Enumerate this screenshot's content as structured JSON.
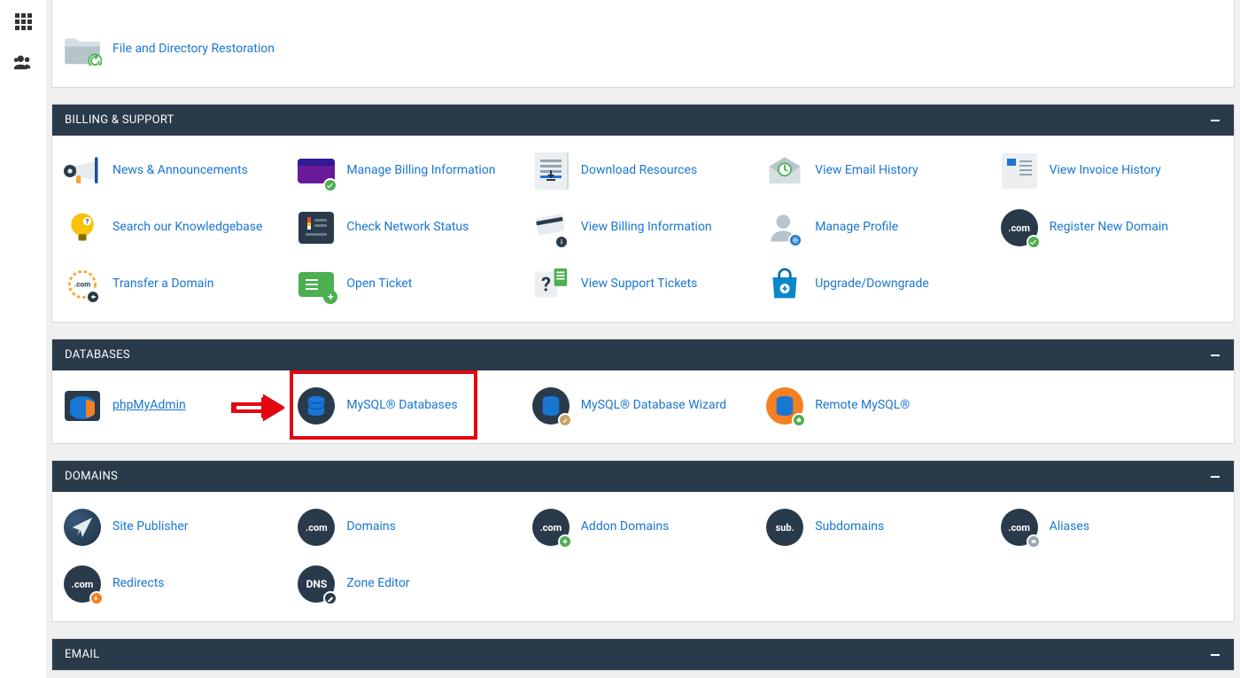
{
  "top": {
    "file_restore": "File and Directory Restoration"
  },
  "billing": {
    "header": "Billing & Support",
    "items": [
      {
        "key": "news",
        "label": "News & Announcements",
        "icon": "bullhorn-icon"
      },
      {
        "key": "manage_billing",
        "label": "Manage Billing Information",
        "icon": "credit-card-icon"
      },
      {
        "key": "download_resources",
        "label": "Download Resources",
        "icon": "download-doc-icon"
      },
      {
        "key": "email_history",
        "label": "View Email History",
        "icon": "envelope-check-icon"
      },
      {
        "key": "invoice_history",
        "label": "View Invoice History",
        "icon": "invoice-list-icon"
      },
      {
        "key": "knowledgebase",
        "label": "Search our Knowledgebase",
        "icon": "lightbulb-icon"
      },
      {
        "key": "network_status",
        "label": "Check Network Status",
        "icon": "gauge-icon"
      },
      {
        "key": "billing_info",
        "label": "View Billing Information",
        "icon": "card-swipe-icon"
      },
      {
        "key": "manage_profile",
        "label": "Manage Profile",
        "icon": "user-gear-icon"
      },
      {
        "key": "register_domain",
        "label": "Register New Domain",
        "icon": "dotcom-check-icon"
      },
      {
        "key": "transfer_domain",
        "label": "Transfer a Domain",
        "icon": "dotcom-transfer-icon"
      },
      {
        "key": "open_ticket",
        "label": "Open Ticket",
        "icon": "ticket-plus-icon"
      },
      {
        "key": "view_tickets",
        "label": "View Support Tickets",
        "icon": "question-ticket-icon"
      },
      {
        "key": "upgrade",
        "label": "Upgrade/Downgrade",
        "icon": "shopping-bag-icon"
      }
    ]
  },
  "databases": {
    "header": "Databases",
    "items": [
      {
        "key": "phpmyadmin",
        "label": "phpMyAdmin",
        "icon": "phpmyadmin-icon",
        "underline": true
      },
      {
        "key": "mysql_db",
        "label": "MySQL® Databases",
        "icon": "database-icon",
        "highlighted": true
      },
      {
        "key": "mysql_wizard",
        "label": "MySQL® Database Wizard",
        "icon": "database-wizard-icon"
      },
      {
        "key": "remote_mysql",
        "label": "Remote MySQL®",
        "icon": "database-remote-icon"
      }
    ]
  },
  "domains": {
    "header": "Domains",
    "items": [
      {
        "key": "site_publisher",
        "label": "Site Publisher",
        "icon": "paper-plane-icon"
      },
      {
        "key": "domains",
        "label": "Domains",
        "icon": "dotcom-icon"
      },
      {
        "key": "addon_domains",
        "label": "Addon Domains",
        "icon": "dotcom-plus-icon"
      },
      {
        "key": "subdomains",
        "label": "Subdomains",
        "icon": "sub-badge-icon"
      },
      {
        "key": "aliases",
        "label": "Aliases",
        "icon": "dotcom-alias-icon"
      },
      {
        "key": "redirects",
        "label": "Redirects",
        "icon": "dotcom-redirect-icon"
      },
      {
        "key": "zone_editor",
        "label": "Zone Editor",
        "icon": "dns-icon"
      }
    ]
  },
  "email": {
    "header": "Email"
  }
}
